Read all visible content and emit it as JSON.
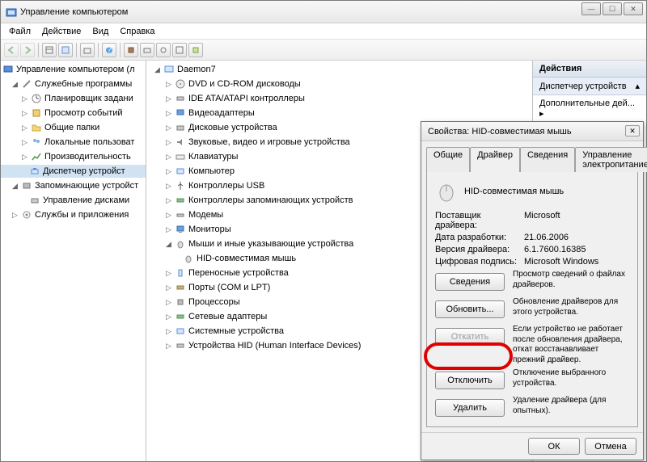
{
  "window": {
    "title": "Управление компьютером"
  },
  "menu": [
    "Файл",
    "Действие",
    "Вид",
    "Справка"
  ],
  "left_tree": {
    "root": "Управление компьютером (л",
    "g1": "Служебные программы",
    "g1_items": [
      "Планировщик задани",
      "Просмотр событий",
      "Общие папки",
      "Локальные пользоват",
      "Производительность",
      "Диспетчер устройст"
    ],
    "g2": "Запоминающие устройст",
    "g2_items": [
      "Управление дисками"
    ],
    "g3": "Службы и приложения"
  },
  "mid_tree": {
    "root": "Daemon7",
    "items": [
      "DVD и CD-ROM дисководы",
      "IDE ATA/ATAPI контроллеры",
      "Видеоадаптеры",
      "Дисковые устройства",
      "Звуковые, видео и игровые устройства",
      "Клавиатуры",
      "Компьютер",
      "Контроллеры USB",
      "Контроллеры запоминающих устройств",
      "Модемы",
      "Мониторы"
    ],
    "mice_group": "Мыши и иные указывающие устройства",
    "mouse_item": "HID-совместимая мышь",
    "items_after": [
      "Переносные устройства",
      "Порты (COM и LPT)",
      "Процессоры",
      "Сетевые адаптеры",
      "Системные устройства",
      "Устройства HID (Human Interface Devices)"
    ]
  },
  "right": {
    "header": "Действия",
    "section": "Диспетчер устройств",
    "more": "Дополнительные дей..."
  },
  "dialog": {
    "title": "Свойства: HID-совместимая мышь",
    "tabs": [
      "Общие",
      "Драйвер",
      "Сведения",
      "Управление электропитанием"
    ],
    "device_name": "HID-совместимая мышь",
    "rows": {
      "vendor_k": "Поставщик драйвера:",
      "vendor_v": "Microsoft",
      "date_k": "Дата разработки:",
      "date_v": "21.06.2006",
      "ver_k": "Версия драйвера:",
      "ver_v": "6.1.7600.16385",
      "sig_k": "Цифровая подпись:",
      "sig_v": "Microsoft Windows"
    },
    "buttons": {
      "details": "Сведения",
      "details_d": "Просмотр сведений о файлах драйверов.",
      "update": "Обновить...",
      "update_d": "Обновление драйверов для этого устройства.",
      "rollback": "Откатить",
      "rollback_d": "Если устройство не работает после обновления драйвера, откат восстанавливает прежний драйвер.",
      "disable": "Отключить",
      "disable_d": "Отключение выбранного устройства.",
      "remove": "Удалить",
      "remove_d": "Удаление драйвера (для опытных)."
    },
    "ok": "ОК",
    "cancel": "Отмена"
  }
}
